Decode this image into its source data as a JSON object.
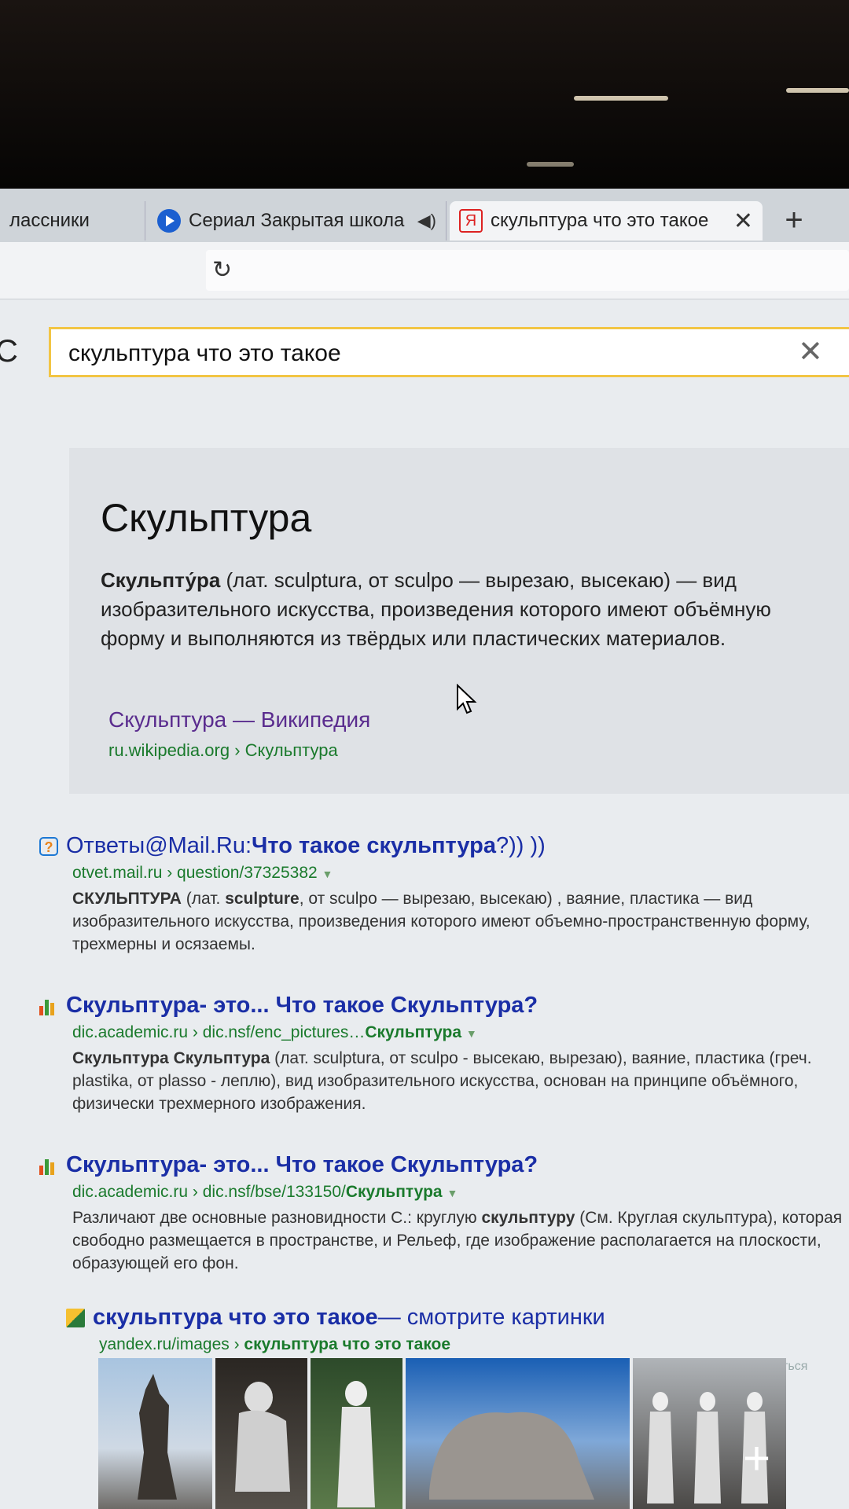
{
  "tabs": [
    {
      "label": "лассники"
    },
    {
      "label": "Сериал Закрытая школа"
    },
    {
      "label": "скульптура что это такое",
      "favicon": "Я"
    }
  ],
  "search": {
    "query": "скульптура что это такое"
  },
  "card": {
    "title": "Скульптура",
    "desc_bold": "Скульпту́ра",
    "desc_rest": " (лат. sculptura, от sculpo — вырезаю, высекаю) — вид изобразительного искусства, произведения которого имеют объёмную форму и выполняются из твёрдых или пластических материалов.",
    "link": "Скульптура — Википедия",
    "source_domain": "ru.wikipedia.org",
    "source_sep": " › ",
    "source_path": "Скульптура"
  },
  "results": [
    {
      "title_a": "Ответы@Mail.Ru: ",
      "title_b": "Что такое скульптура",
      "title_c": "?)) ))",
      "url_a": "otvet.mail.ru › question/37325382",
      "url_b": "",
      "snip_b1": "СКУЛЬПТУРА",
      "snip_t1": " (лат. ",
      "snip_b2": "sculpture",
      "snip_t2": ", от sculpo — вырезаю, высекаю) , ваяние, пластика — вид изобразительного искусства, произведения которого имеют объемно-пространственную форму, трехмерны и осязаемы."
    },
    {
      "title_a": "",
      "title_b": "Скульптура",
      "title_c": " - это... Что такое Скульптура?",
      "url_a": "dic.academic.ru › dic.nsf/enc_pictures…",
      "url_b": "Скульптура",
      "snip_b1": "Скульптура Скульптура",
      "snip_t1": " (лат. sculptura, от sculpo - высекаю, вырезаю), ваяние, пластика (греч. plastika, от plasso - леплю), вид изобразительного искусства, основан на принципе объёмного, физически трехмерного изображения.",
      "snip_b2": "",
      "snip_t2": ""
    },
    {
      "title_a": "",
      "title_b": "Скульптура",
      "title_c": " - это... Что такое Скульптура?",
      "url_a": "dic.academic.ru › dic.nsf/bse/133150/",
      "url_b": "Скульптура",
      "snip_b1": "",
      "snip_t1": "Различают две основные разновидности С.: круглую ",
      "snip_b2": "скульптуру",
      "snip_t2": " (См. Круглая скульптура), которая свободно размещается в пространстве, и Рельеф, где изображение располагается на плоскости, образующей его фон."
    },
    {
      "title_a": "",
      "title_b": "скульптура что это такое",
      "title_c": " — смотрите картинки",
      "url_a": "yandex.ru/images › ",
      "url_b": "скульптура что это такое",
      "snip_b1": "",
      "snip_t1": "",
      "snip_b2": "",
      "snip_t2": ""
    }
  ],
  "images": {
    "complain": "Пожаловаться"
  },
  "colors": {
    "accent": "#f2c544",
    "link": "#1a2ea6",
    "url": "#1a7a2c",
    "visited": "#5a2c8e"
  }
}
